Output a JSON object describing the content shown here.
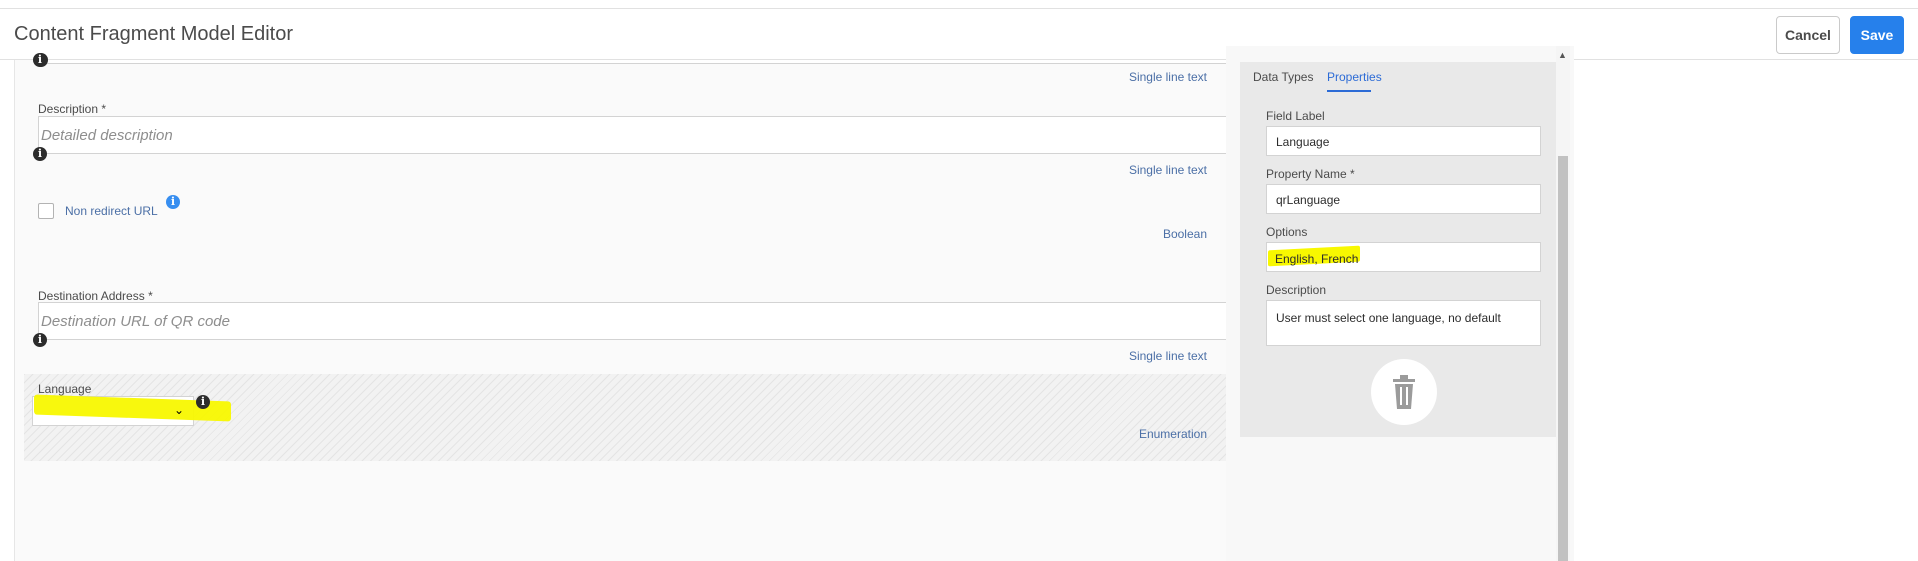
{
  "header": {
    "title": "Content Fragment Model Editor",
    "cancel_label": "Cancel",
    "save_label": "Save"
  },
  "form": {
    "top_field_type": "Single line text",
    "description": {
      "label": "Description *",
      "placeholder": "Detailed description",
      "type": "Single line text"
    },
    "non_redirect": {
      "label": "Non redirect URL",
      "type": "Boolean"
    },
    "destination": {
      "label": "Destination Address *",
      "placeholder": "Destination URL of QR code",
      "type": "Single line text"
    },
    "language": {
      "label": "Language",
      "type": "Enumeration"
    }
  },
  "side_panel": {
    "tabs": [
      {
        "label": "Data Types",
        "active": false
      },
      {
        "label": "Properties",
        "active": true
      }
    ],
    "field_label": {
      "label": "Field Label",
      "value": "Language"
    },
    "property_name": {
      "label": "Property Name *",
      "value": "qrLanguage"
    },
    "options": {
      "label": "Options",
      "value": "English, French"
    },
    "description": {
      "label": "Description",
      "value": "User must select one language, no default"
    }
  },
  "colors": {
    "accent": "#2680eb",
    "highlight": "#f8f800",
    "link": "#4b6fa6"
  },
  "icons": [
    "info-icon",
    "chevron-down-icon",
    "trash-icon"
  ]
}
